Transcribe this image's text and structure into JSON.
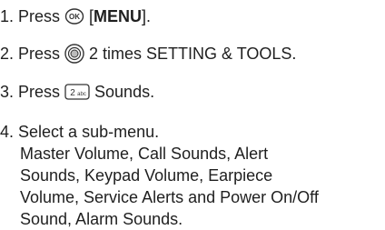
{
  "steps": [
    {
      "number": "1.",
      "before": "Press",
      "icon": "ok-key-icon",
      "bracket_open": "[",
      "bold_text": "MENU",
      "bracket_close": "].",
      "after": ""
    },
    {
      "number": "2.",
      "before": "Press",
      "icon": "navigation-key-icon",
      "after": "2 times SETTING & TOOLS."
    },
    {
      "number": "3.",
      "before": "Press",
      "icon": "2-abc-key-icon",
      "icon_text": "2",
      "icon_subtext": "abc",
      "after": "Sounds."
    },
    {
      "number": "4.",
      "text": "Select a sub-menu.",
      "submenu_lines": [
        "Master Volume, Call Sounds, Alert",
        "Sounds, Keypad Volume, Earpiece",
        "Volume, Service Alerts and Power On/Off",
        "Sound, Alarm Sounds."
      ]
    }
  ]
}
